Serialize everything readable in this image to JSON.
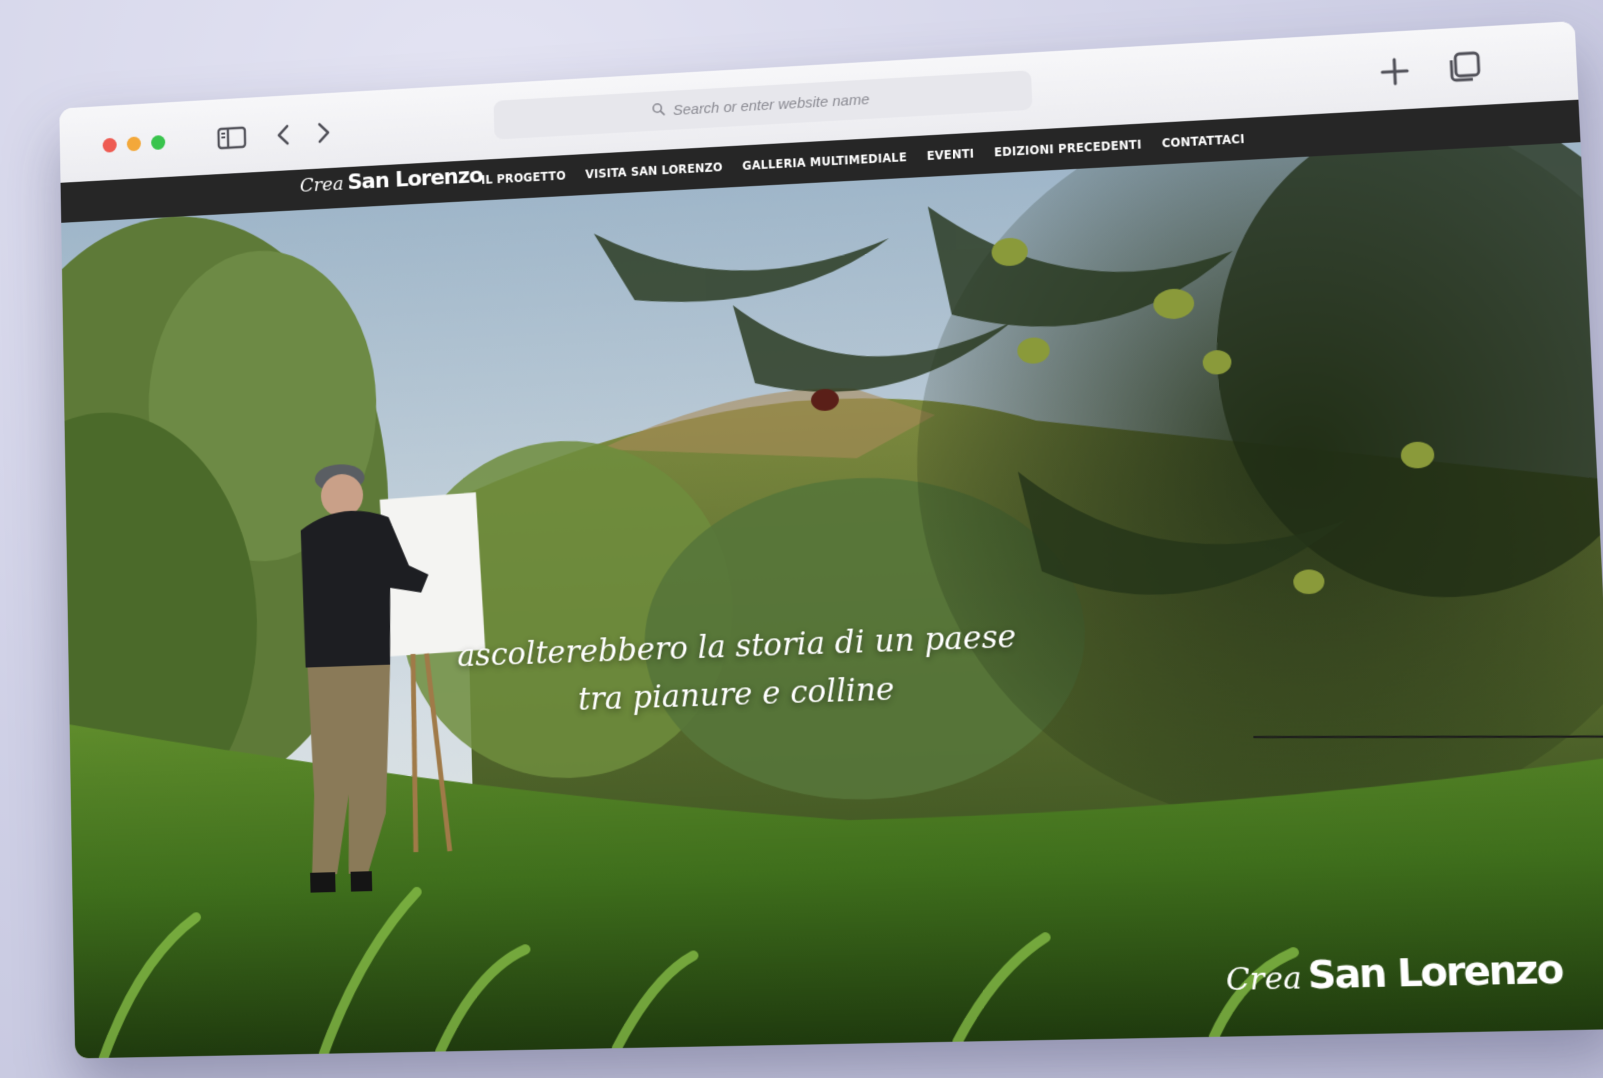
{
  "browser": {
    "address_placeholder": "Search or enter website name",
    "icons": [
      "sidebar-icon",
      "back-icon",
      "forward-icon",
      "search-icon",
      "new-tab-icon",
      "tabs-overview-icon"
    ]
  },
  "site": {
    "logo": {
      "script": "Crea",
      "bold": "San Lorenzo"
    },
    "menu": [
      {
        "label": "IL PROGETTO"
      },
      {
        "label": "VISITA SAN LORENZO"
      },
      {
        "label": "GALLERIA MULTIMEDIALE"
      },
      {
        "label": "EVENTI"
      },
      {
        "label": "EDIZIONI PRECEDENTI"
      },
      {
        "label": "CONTATTACI"
      }
    ],
    "hero": {
      "caption_line1": "ascolterebbero la storia di un paese",
      "caption_line2": "tra pianure e colline"
    },
    "footer_logo": {
      "script": "Crea",
      "bold": "San Lorenzo"
    }
  },
  "colors": {
    "navbar": "#262626",
    "traffic_red": "#ee5b52",
    "traffic_yellow": "#f3a83a",
    "traffic_green": "#39c44d"
  }
}
